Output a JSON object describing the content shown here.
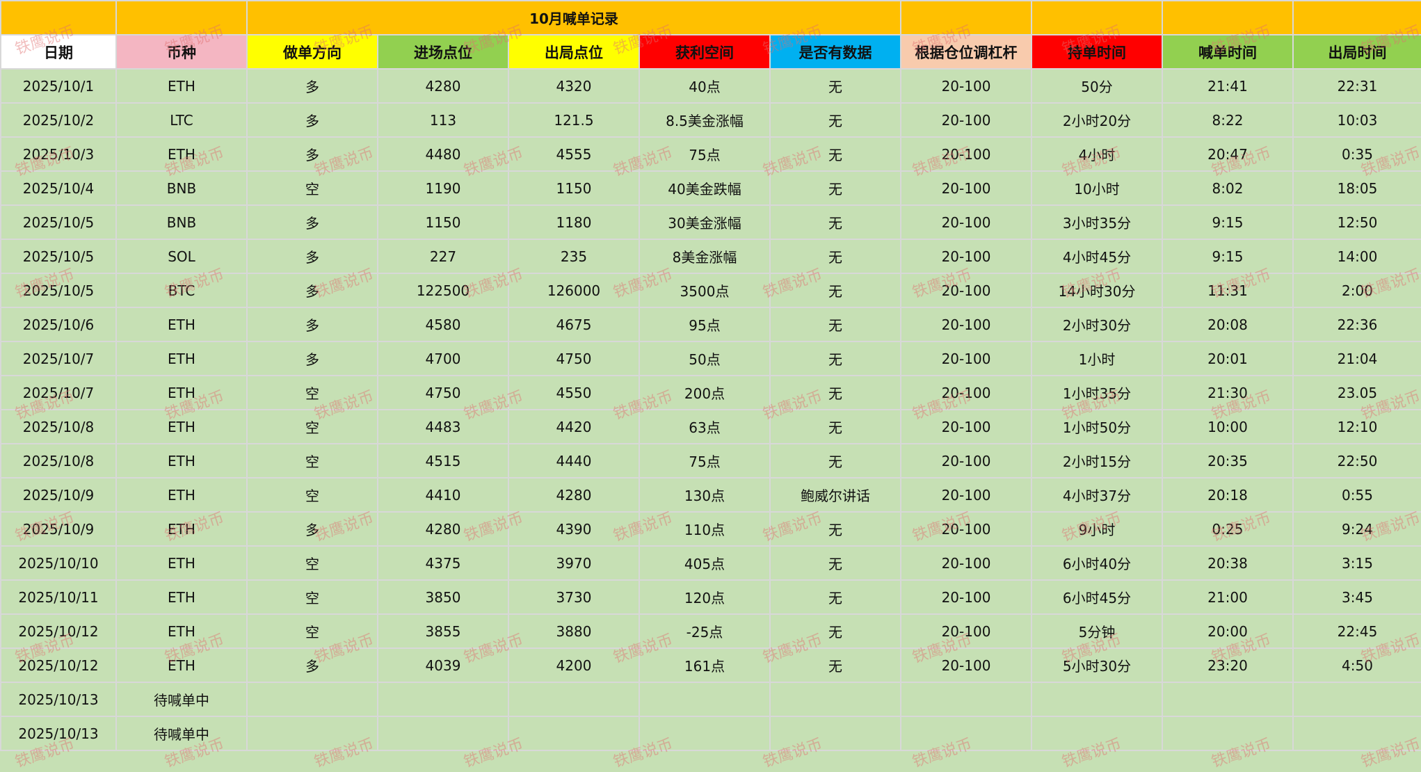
{
  "sheet": {
    "title": "10月喊单记录",
    "headers": [
      "日期",
      "币种",
      "做单方向",
      "进场点位",
      "出局点位",
      "获利空间",
      "是否有数据",
      "根据仓位调杠杆",
      "持单时间",
      "喊单时间",
      "出局时间"
    ],
    "header_colors": [
      "#ffffff",
      "#f4b6c2",
      "#ffff00",
      "#92d050",
      "#ffff00",
      "#ff0000",
      "#00b0f0",
      "#f8cbad",
      "#ff0000",
      "#92d050",
      "#92d050"
    ],
    "rows": [
      {
        "date": "2025/10/1",
        "coin": "ETH",
        "dir": "多",
        "entry": "4280",
        "exit": "4320",
        "profit": "40点",
        "data": "无",
        "lev": "20-100",
        "hold": "50分",
        "call": "21:41",
        "out": "22:31",
        "pstyle": "light"
      },
      {
        "date": "2025/10/2",
        "coin": "LTC",
        "dir": "多",
        "entry": "113",
        "exit": "121.5",
        "profit": "8.5美金涨幅",
        "data": "无",
        "lev": "20-100",
        "hold": "2小时20分",
        "call": "8:22",
        "out": "10:03",
        "pstyle": "bright"
      },
      {
        "date": "2025/10/3",
        "coin": "ETH",
        "dir": "多",
        "entry": "4480",
        "exit": "4555",
        "profit": "75点",
        "data": "无",
        "lev": "20-100",
        "hold": "4小时",
        "call": "20:47",
        "out": "0:35",
        "pstyle": "bright"
      },
      {
        "date": "2025/10/4",
        "coin": "BNB",
        "dir": "空",
        "entry": "1190",
        "exit": "1150",
        "profit": "40美金跌幅",
        "data": "无",
        "lev": "20-100",
        "hold": "10小时",
        "call": "8:02",
        "out": "18:05",
        "pstyle": "bright"
      },
      {
        "date": "2025/10/5",
        "coin": "BNB",
        "dir": "多",
        "entry": "1150",
        "exit": "1180",
        "profit": "30美金涨幅",
        "data": "无",
        "lev": "20-100",
        "hold": "3小时35分",
        "call": "9:15",
        "out": "12:50",
        "pstyle": "bright"
      },
      {
        "date": "2025/10/5",
        "coin": "SOL",
        "dir": "多",
        "entry": "227",
        "exit": "235",
        "profit": "8美金涨幅",
        "data": "无",
        "lev": "20-100",
        "hold": "4小时45分",
        "call": "9:15",
        "out": "14:00",
        "pstyle": "bright"
      },
      {
        "date": "2025/10/5",
        "coin": "BTC",
        "dir": "多",
        "entry": "122500",
        "exit": "126000",
        "profit": "3500点",
        "data": "无",
        "lev": "20-100",
        "hold": "14小时30分",
        "call": "11:31",
        "out": "2:00",
        "pstyle": "bright"
      },
      {
        "date": "2025/10/6",
        "coin": "ETH",
        "dir": "多",
        "entry": "4580",
        "exit": "4675",
        "profit": "95点",
        "data": "无",
        "lev": "20-100",
        "hold": "2小时30分",
        "call": "20:08",
        "out": "22:36",
        "pstyle": "bright"
      },
      {
        "date": "2025/10/7",
        "coin": "ETH",
        "dir": "多",
        "entry": "4700",
        "exit": "4750",
        "profit": "50点",
        "data": "无",
        "lev": "20-100",
        "hold": "1小时",
        "call": "20:01",
        "out": "21:04",
        "pstyle": "bright"
      },
      {
        "date": "2025/10/7",
        "coin": "ETH",
        "dir": "空",
        "entry": "4750",
        "exit": "4550",
        "profit": "200点",
        "data": "无",
        "lev": "20-100",
        "hold": "1小时35分",
        "call": "21:30",
        "out": "23.05",
        "pstyle": "bright"
      },
      {
        "date": "2025/10/8",
        "coin": "ETH",
        "dir": "空",
        "entry": "4483",
        "exit": "4420",
        "profit": "63点",
        "data": "无",
        "lev": "20-100",
        "hold": "1小时50分",
        "call": "10:00",
        "out": "12:10",
        "pstyle": "bright"
      },
      {
        "date": "2025/10/8",
        "coin": "ETH",
        "dir": "空",
        "entry": "4515",
        "exit": "4440",
        "profit": "75点",
        "data": "无",
        "lev": "20-100",
        "hold": "2小时15分",
        "call": "20:35",
        "out": "22:50",
        "pstyle": "bright"
      },
      {
        "date": "2025/10/9",
        "coin": "ETH",
        "dir": "空",
        "entry": "4410",
        "exit": "4280",
        "profit": "130点",
        "data": "鲍威尔讲话",
        "lev": "20-100",
        "hold": "4小时37分",
        "call": "20:18",
        "out": "0:55",
        "pstyle": "bright"
      },
      {
        "date": "2025/10/9",
        "coin": "ETH",
        "dir": "多",
        "entry": "4280",
        "exit": "4390",
        "profit": "110点",
        "data": "无",
        "lev": "20-100",
        "hold": "9小时",
        "call": "0:25",
        "out": "9:24",
        "pstyle": "bright"
      },
      {
        "date": "2025/10/10",
        "coin": "ETH",
        "dir": "空",
        "entry": "4375",
        "exit": "3970",
        "profit": "405点",
        "data": "无",
        "lev": "20-100",
        "hold": "6小时40分",
        "call": "20:38",
        "out": "3:15",
        "pstyle": "bright"
      },
      {
        "date": "2025/10/11",
        "coin": "ETH",
        "dir": "空",
        "entry": "3850",
        "exit": "3730",
        "profit": "120点",
        "data": "无",
        "lev": "20-100",
        "hold": "6小时45分",
        "call": "21:00",
        "out": "3:45",
        "pstyle": "bright"
      },
      {
        "date": "2025/10/12",
        "coin": "ETH",
        "dir": "空",
        "entry": "3855",
        "exit": "3880",
        "profit": "-25点",
        "data": "无",
        "lev": "20-100",
        "hold": "5分钟",
        "call": "20:00",
        "out": "22:45",
        "pstyle": "loss"
      },
      {
        "date": "2025/10/12",
        "coin": "ETH",
        "dir": "多",
        "entry": "4039",
        "exit": "4200",
        "profit": "161点",
        "data": "无",
        "lev": "20-100",
        "hold": "5小时30分",
        "call": "23:20",
        "out": "4:50",
        "pstyle": "bright"
      },
      {
        "date": "2025/10/13",
        "coin": "待喊单中",
        "dir": "",
        "entry": "",
        "exit": "",
        "profit": "",
        "data": "",
        "lev": "",
        "hold": "",
        "call": "",
        "out": "",
        "pstyle": "none"
      },
      {
        "date": "2025/10/13",
        "coin": "待喊单中",
        "dir": "",
        "entry": "",
        "exit": "",
        "profit": "",
        "data": "",
        "lev": "",
        "hold": "",
        "call": "",
        "out": "",
        "pstyle": "none"
      }
    ]
  },
  "watermark": "铁鹰说币"
}
